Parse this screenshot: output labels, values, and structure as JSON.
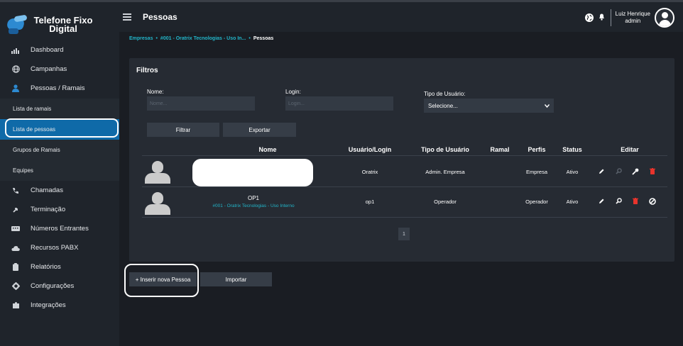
{
  "app": {
    "logo_line1": "Telefone Fixo",
    "logo_line2": "Digital"
  },
  "sidebar": {
    "items": [
      {
        "label": "Dashboard",
        "icon": "chart-icon"
      },
      {
        "label": "Campanhas",
        "icon": "globe-icon"
      },
      {
        "label": "Pessoas / Ramais",
        "icon": "person-icon"
      }
    ],
    "subitems": [
      {
        "label": "Lista de ramais"
      },
      {
        "label": "Lista de pessoas",
        "active": true
      },
      {
        "label": "Grupos de Ramais"
      },
      {
        "label": "Equipes"
      }
    ],
    "items2": [
      {
        "label": "Chamadas",
        "icon": "phone-icon"
      },
      {
        "label": "Terminação",
        "icon": "arrow-icon"
      },
      {
        "label": "Números Entrantes",
        "icon": "keypad-icon"
      },
      {
        "label": "Recursos PABX",
        "icon": "cloud-icon"
      },
      {
        "label": "Relatórios",
        "icon": "clipboard-icon"
      },
      {
        "label": "Configurações",
        "icon": "gear-icon"
      },
      {
        "label": "Integrações",
        "icon": "puzzle-icon"
      }
    ]
  },
  "header": {
    "title": "Pessoas",
    "user_name": "Luiz Henrique",
    "user_role": "admin"
  },
  "breadcrumb": {
    "items": [
      "Empresas",
      "#001 - Oratrix Tecnologias - Uso In...",
      "Pessoas"
    ],
    "separator": "•"
  },
  "filters": {
    "title": "Filtros",
    "name_label": "Nome:",
    "name_placeholder": "Nome...",
    "login_label": "Login:",
    "login_placeholder": "Login...",
    "type_label": "Tipo de Usuário:",
    "type_selected": "Selecione...",
    "filter_button": "Filtrar",
    "export_button": "Exportar"
  },
  "table": {
    "columns": [
      "Nome",
      "Usuário/Login",
      "Tipo de Usuário",
      "Ramal",
      "Perfis",
      "Status",
      "Editar"
    ],
    "rows": [
      {
        "name": "",
        "company": "",
        "login": "Oratrix",
        "type": "Admin. Empresa",
        "ramal": "",
        "profile": "Empresa",
        "status": "Ativo"
      },
      {
        "name": "OP1",
        "company": "#001 - Oratrix Tecnologias - Uso Interno",
        "login": "op1",
        "type": "Operador",
        "ramal": "",
        "profile": "Operador",
        "status": "Ativo"
      }
    ]
  },
  "pagination": {
    "current": "1"
  },
  "actions": {
    "insert_button": "+ Inserir nova Pessoa",
    "import_button": "Importar"
  },
  "colors": {
    "accent": "#0f6aa8",
    "link": "#22b5c9",
    "danger": "#e8342c"
  }
}
